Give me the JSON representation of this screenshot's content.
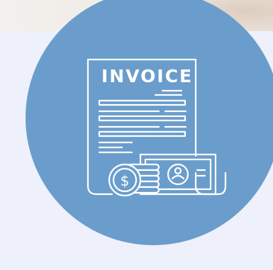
{
  "invoice": {
    "title": "INVOICE",
    "icon": "invoice-document-icon",
    "coin_symbol": "$",
    "colors": {
      "background": "#eef0fb",
      "circle": "#6a9dcb",
      "line": "#ffffff"
    }
  }
}
